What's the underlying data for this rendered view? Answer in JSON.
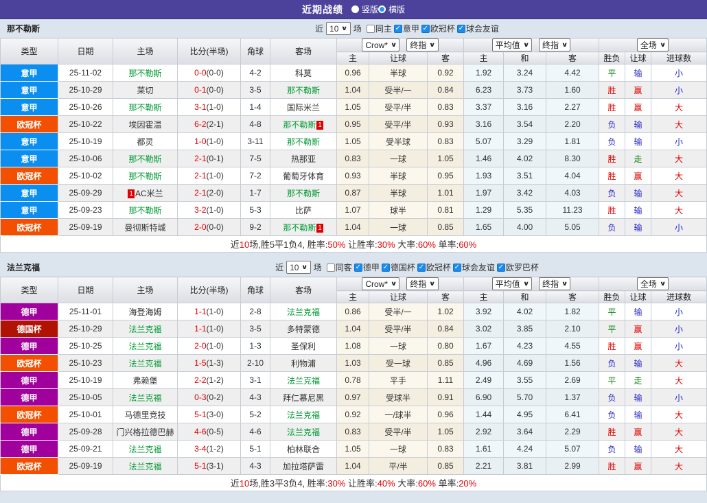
{
  "titlebar": {
    "title": "近期战绩",
    "radios": [
      {
        "label": "竖版",
        "selected": true
      },
      {
        "label": "横版",
        "selected": false
      }
    ]
  },
  "table_header": {
    "cols": [
      "类型",
      "日期",
      "主场",
      "比分(半场)",
      "角球",
      "客场"
    ],
    "group_dropdowns": [
      [
        "Crow*",
        "终指"
      ],
      [
        "平均值",
        "终指"
      ],
      [
        "全场"
      ]
    ],
    "sub_cols": [
      "主",
      "让球",
      "客",
      "主",
      "和",
      "客",
      "胜负",
      "让球",
      "进球数"
    ]
  },
  "league_colors": {
    "意甲": "#0a8ff0",
    "欧冠杯": "#f25000",
    "德甲": "#a0009b",
    "德国杯": "#b01303"
  },
  "result_colors": {
    "r": "#e00000",
    "b": "#2424cc",
    "g": "#008000"
  },
  "sections": [
    {
      "team": "那不勒斯",
      "filter": {
        "near": "近",
        "count": "10",
        "unit": "场",
        "checkboxes": [
          {
            "label": "同主",
            "checked": false
          },
          {
            "label": "意甲",
            "checked": true
          },
          {
            "label": "欧冠杯",
            "checked": true
          },
          {
            "label": "球会友谊",
            "checked": true
          }
        ]
      },
      "rows": [
        {
          "lg": "意甲",
          "dt": "25-11-02",
          "h": {
            "n": "那不勒斯",
            "s": 1
          },
          "ft": "0-0",
          "ht": "(0-0)",
          "cn": "4-2",
          "a": {
            "n": "科莫"
          },
          "od": [
            "0.96",
            "半球",
            "0.92",
            "1.92",
            "3.24",
            "4.42"
          ],
          "rs": [
            [
              "平",
              "g"
            ],
            [
              "输",
              "b"
            ],
            [
              "小",
              "b"
            ]
          ]
        },
        {
          "lg": "意甲",
          "dt": "25-10-29",
          "h": {
            "n": "莱切"
          },
          "ft": "0-1",
          "ht": "(0-0)",
          "cn": "3-5",
          "a": {
            "n": "那不勒斯",
            "s": 1
          },
          "od": [
            "1.04",
            "受半/一",
            "0.84",
            "6.23",
            "3.73",
            "1.60"
          ],
          "rs": [
            [
              "胜",
              "r"
            ],
            [
              "赢",
              "r"
            ],
            [
              "小",
              "b"
            ]
          ]
        },
        {
          "lg": "意甲",
          "dt": "25-10-26",
          "h": {
            "n": "那不勒斯",
            "s": 1
          },
          "ft": "3-1",
          "ht": "(1-0)",
          "cn": "1-4",
          "a": {
            "n": "国际米兰"
          },
          "od": [
            "1.05",
            "受平/半",
            "0.83",
            "3.37",
            "3.16",
            "2.27"
          ],
          "rs": [
            [
              "胜",
              "r"
            ],
            [
              "赢",
              "r"
            ],
            [
              "大",
              "r"
            ]
          ]
        },
        {
          "lg": "欧冠杯",
          "dt": "25-10-22",
          "h": {
            "n": "埃因霍温"
          },
          "ft": "6-2",
          "ht": "(2-1)",
          "cn": "4-8",
          "a": {
            "n": "那不勒斯",
            "s": 1,
            "ba": "1"
          },
          "od": [
            "0.95",
            "受平/半",
            "0.93",
            "3.16",
            "3.54",
            "2.20"
          ],
          "rs": [
            [
              "负",
              "b"
            ],
            [
              "输",
              "b"
            ],
            [
              "大",
              "r"
            ]
          ]
        },
        {
          "lg": "意甲",
          "dt": "25-10-19",
          "h": {
            "n": "都灵"
          },
          "ft": "1-0",
          "ht": "(1-0)",
          "cn": "3-11",
          "a": {
            "n": "那不勒斯",
            "s": 1
          },
          "od": [
            "1.05",
            "受半球",
            "0.83",
            "5.07",
            "3.29",
            "1.81"
          ],
          "rs": [
            [
              "负",
              "b"
            ],
            [
              "输",
              "b"
            ],
            [
              "小",
              "b"
            ]
          ]
        },
        {
          "lg": "意甲",
          "dt": "25-10-06",
          "h": {
            "n": "那不勒斯",
            "s": 1
          },
          "ft": "2-1",
          "ht": "(0-1)",
          "cn": "7-5",
          "a": {
            "n": "热那亚"
          },
          "od": [
            "0.83",
            "一球",
            "1.05",
            "1.46",
            "4.02",
            "8.30"
          ],
          "rs": [
            [
              "胜",
              "r"
            ],
            [
              "走",
              "g"
            ],
            [
              "大",
              "r"
            ]
          ]
        },
        {
          "lg": "欧冠杯",
          "dt": "25-10-02",
          "h": {
            "n": "那不勒斯",
            "s": 1
          },
          "ft": "2-1",
          "ht": "(1-0)",
          "cn": "7-2",
          "a": {
            "n": "葡萄牙体育"
          },
          "od": [
            "0.93",
            "半球",
            "0.95",
            "1.93",
            "3.51",
            "4.04"
          ],
          "rs": [
            [
              "胜",
              "r"
            ],
            [
              "赢",
              "r"
            ],
            [
              "大",
              "r"
            ]
          ]
        },
        {
          "lg": "意甲",
          "dt": "25-09-29",
          "h": {
            "n": "AC米兰",
            "bb": "1"
          },
          "ft": "2-1",
          "ht": "(2-0)",
          "cn": "1-7",
          "a": {
            "n": "那不勒斯",
            "s": 1
          },
          "od": [
            "0.87",
            "半球",
            "1.01",
            "1.97",
            "3.42",
            "4.03"
          ],
          "rs": [
            [
              "负",
              "b"
            ],
            [
              "输",
              "b"
            ],
            [
              "大",
              "r"
            ]
          ]
        },
        {
          "lg": "意甲",
          "dt": "25-09-23",
          "h": {
            "n": "那不勒斯",
            "s": 1
          },
          "ft": "3-2",
          "ht": "(1-0)",
          "cn": "5-3",
          "a": {
            "n": "比萨"
          },
          "od": [
            "1.07",
            "球半",
            "0.81",
            "1.29",
            "5.35",
            "11.23"
          ],
          "rs": [
            [
              "胜",
              "r"
            ],
            [
              "输",
              "b"
            ],
            [
              "大",
              "r"
            ]
          ]
        },
        {
          "lg": "欧冠杯",
          "dt": "25-09-19",
          "h": {
            "n": "曼彻斯特城"
          },
          "ft": "2-0",
          "ht": "(0-0)",
          "cn": "9-2",
          "a": {
            "n": "那不勒斯",
            "s": 1,
            "ba": "1"
          },
          "od": [
            "1.04",
            "一球",
            "0.85",
            "1.65",
            "4.00",
            "5.05"
          ],
          "rs": [
            [
              "负",
              "b"
            ],
            [
              "输",
              "b"
            ],
            [
              "小",
              "b"
            ]
          ]
        }
      ],
      "summary": [
        {
          "text": "近",
          "red": false
        },
        {
          "text": "10",
          "red": true
        },
        {
          "text": "场,胜5平1负4, 胜率:",
          "red": false
        },
        {
          "text": "50%",
          "red": true
        },
        {
          "text": " 让胜率:",
          "red": false
        },
        {
          "text": "30%",
          "red": true
        },
        {
          "text": " 大率:",
          "red": false
        },
        {
          "text": "60%",
          "red": true
        },
        {
          "text": " 单率:",
          "red": false
        },
        {
          "text": "60%",
          "red": true
        }
      ]
    },
    {
      "team": "法兰克福",
      "filter": {
        "near": "近",
        "count": "10",
        "unit": "场",
        "checkboxes": [
          {
            "label": "同客",
            "checked": false
          },
          {
            "label": "德甲",
            "checked": true
          },
          {
            "label": "德国杯",
            "checked": true
          },
          {
            "label": "欧冠杯",
            "checked": true
          },
          {
            "label": "球会友谊",
            "checked": true
          },
          {
            "label": "欧罗巴杯",
            "checked": true
          }
        ]
      },
      "rows": [
        {
          "lg": "德甲",
          "dt": "25-11-01",
          "h": {
            "n": "海登海姆"
          },
          "ft": "1-1",
          "ht": "(1-0)",
          "cn": "2-8",
          "a": {
            "n": "法兰克福",
            "s": 1
          },
          "od": [
            "0.86",
            "受半/一",
            "1.02",
            "3.92",
            "4.02",
            "1.82"
          ],
          "rs": [
            [
              "平",
              "g"
            ],
            [
              "输",
              "b"
            ],
            [
              "小",
              "b"
            ]
          ]
        },
        {
          "lg": "德国杯",
          "dt": "25-10-29",
          "h": {
            "n": "法兰克福",
            "s": 1
          },
          "ft": "1-1",
          "ht": "(1-0)",
          "cn": "3-5",
          "a": {
            "n": "多特蒙德"
          },
          "od": [
            "1.04",
            "受平/半",
            "0.84",
            "3.02",
            "3.85",
            "2.10"
          ],
          "rs": [
            [
              "平",
              "g"
            ],
            [
              "赢",
              "r"
            ],
            [
              "小",
              "b"
            ]
          ]
        },
        {
          "lg": "德甲",
          "dt": "25-10-25",
          "h": {
            "n": "法兰克福",
            "s": 1
          },
          "ft": "2-0",
          "ht": "(1-0)",
          "cn": "1-3",
          "a": {
            "n": "圣保利"
          },
          "od": [
            "1.08",
            "一球",
            "0.80",
            "1.67",
            "4.23",
            "4.55"
          ],
          "rs": [
            [
              "胜",
              "r"
            ],
            [
              "赢",
              "r"
            ],
            [
              "小",
              "b"
            ]
          ]
        },
        {
          "lg": "欧冠杯",
          "dt": "25-10-23",
          "h": {
            "n": "法兰克福",
            "s": 1
          },
          "ft": "1-5",
          "ht": "(1-3)",
          "cn": "2-10",
          "a": {
            "n": "利物浦"
          },
          "od": [
            "1.03",
            "受一球",
            "0.85",
            "4.96",
            "4.69",
            "1.56"
          ],
          "rs": [
            [
              "负",
              "b"
            ],
            [
              "输",
              "b"
            ],
            [
              "大",
              "r"
            ]
          ]
        },
        {
          "lg": "德甲",
          "dt": "25-10-19",
          "h": {
            "n": "弗赖堡"
          },
          "ft": "2-2",
          "ht": "(1-2)",
          "cn": "3-1",
          "a": {
            "n": "法兰克福",
            "s": 1
          },
          "od": [
            "0.78",
            "平手",
            "1.11",
            "2.49",
            "3.55",
            "2.69"
          ],
          "rs": [
            [
              "平",
              "g"
            ],
            [
              "走",
              "g"
            ],
            [
              "大",
              "r"
            ]
          ]
        },
        {
          "lg": "德甲",
          "dt": "25-10-05",
          "h": {
            "n": "法兰克福",
            "s": 1
          },
          "ft": "0-3",
          "ht": "(0-2)",
          "cn": "4-3",
          "a": {
            "n": "拜仁慕尼黑"
          },
          "od": [
            "0.97",
            "受球半",
            "0.91",
            "6.90",
            "5.70",
            "1.37"
          ],
          "rs": [
            [
              "负",
              "b"
            ],
            [
              "输",
              "b"
            ],
            [
              "小",
              "b"
            ]
          ]
        },
        {
          "lg": "欧冠杯",
          "dt": "25-10-01",
          "h": {
            "n": "马德里竞技"
          },
          "ft": "5-1",
          "ht": "(3-0)",
          "cn": "5-2",
          "a": {
            "n": "法兰克福",
            "s": 1
          },
          "od": [
            "0.92",
            "一/球半",
            "0.96",
            "1.44",
            "4.95",
            "6.41"
          ],
          "rs": [
            [
              "负",
              "b"
            ],
            [
              "输",
              "b"
            ],
            [
              "大",
              "r"
            ]
          ]
        },
        {
          "lg": "德甲",
          "dt": "25-09-28",
          "h": {
            "n": "门兴格拉德巴赫"
          },
          "ft": "4-6",
          "ht": "(0-5)",
          "cn": "4-6",
          "a": {
            "n": "法兰克福",
            "s": 1
          },
          "od": [
            "0.83",
            "受平/半",
            "1.05",
            "2.92",
            "3.64",
            "2.29"
          ],
          "rs": [
            [
              "胜",
              "r"
            ],
            [
              "赢",
              "r"
            ],
            [
              "大",
              "r"
            ]
          ]
        },
        {
          "lg": "德甲",
          "dt": "25-09-21",
          "h": {
            "n": "法兰克福",
            "s": 1
          },
          "ft": "3-4",
          "ht": "(1-2)",
          "cn": "5-1",
          "a": {
            "n": "柏林联合"
          },
          "od": [
            "1.05",
            "一球",
            "0.83",
            "1.61",
            "4.24",
            "5.07"
          ],
          "rs": [
            [
              "负",
              "b"
            ],
            [
              "输",
              "b"
            ],
            [
              "大",
              "r"
            ]
          ]
        },
        {
          "lg": "欧冠杯",
          "dt": "25-09-19",
          "h": {
            "n": "法兰克福",
            "s": 1
          },
          "ft": "5-1",
          "ht": "(3-1)",
          "cn": "4-3",
          "a": {
            "n": "加拉塔萨雷"
          },
          "od": [
            "1.04",
            "平/半",
            "0.85",
            "2.21",
            "3.81",
            "2.99"
          ],
          "rs": [
            [
              "胜",
              "r"
            ],
            [
              "赢",
              "r"
            ],
            [
              "大",
              "r"
            ]
          ]
        }
      ],
      "summary": [
        {
          "text": "近",
          "red": false
        },
        {
          "text": "10",
          "red": true
        },
        {
          "text": "场,胜3平3负4, 胜率:",
          "red": false
        },
        {
          "text": "30%",
          "red": true
        },
        {
          "text": " 让胜率:",
          "red": false
        },
        {
          "text": "40%",
          "red": true
        },
        {
          "text": " 大率:",
          "red": false
        },
        {
          "text": "60%",
          "red": true
        },
        {
          "text": " 单率:",
          "red": false
        },
        {
          "text": "20%",
          "red": true
        }
      ]
    }
  ]
}
